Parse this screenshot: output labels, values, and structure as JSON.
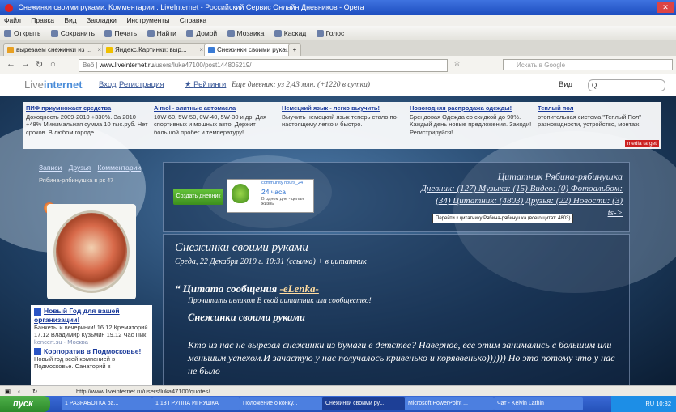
{
  "browser": {
    "title": "Снежинки своими руками. Комментарии : LiveInternet - Российский Сервис Онлайн Дневников - Opera",
    "menu": [
      "Файл",
      "Правка",
      "Вид",
      "Закладки",
      "Инструменты",
      "Справка"
    ],
    "toolbar": [
      "Открыть",
      "Сохранить",
      "Печать",
      "Найти",
      "Домой",
      "Мозаика",
      "Каскад",
      "Голос"
    ],
    "tabs": [
      "вырезаем снежинки из ...",
      "Яндекс.Картинки: выр...",
      "Снежинки своими рука..."
    ],
    "url_prefix": "Веб",
    "url_host": "www.liveinternet.ru",
    "url_path": "/users/luka47100/post144805219/",
    "search_placeholder": "Искать в Google"
  },
  "site": {
    "logo_a": "Live",
    "logo_b": "internet",
    "login": "Вход",
    "register": "Регистрация",
    "ratings": "Рейтинги",
    "stats_text": "Еще дневник: уз 2,43 млн. (+1220 в сутки)",
    "search_label": "Вид",
    "search_placeholder": "Q"
  },
  "ads": [
    {
      "title": "ПИФ приумножает средства",
      "text": "Доходность 2009-2010 +330%. За 2010 +48% Минимальная сумма 10 тыс.руб. Нет сроков. В любом городе"
    },
    {
      "title": "Aimol - элитные автомасла",
      "text": "10W-60, 5W-50, 0W-40, 5W-30 и др. Для спортивных и мощных авто. Держит большой пробег и температуру!"
    },
    {
      "title": "Немецкий язык - легко выучить!",
      "text": "Выучить немецкий язык теперь стало по-настоящему легко и быстро."
    },
    {
      "title": "Новогодняя распродажа одежды!",
      "text": "Брендовая Одежда со скидкой до 90%. Каждый день новые предложения. Заходи! Регистрируйся!"
    },
    {
      "title": "Теплый пол",
      "text": "отопительная система \"Теплый Пол\" разновидности, устройство, монтаж."
    }
  ],
  "media_target": "media target",
  "user_nav": [
    "Записи",
    "Друзья",
    "Комментарии"
  ],
  "greeting": "Рябина-рябинушка в рк 47",
  "sidebar_ads": [
    {
      "title": "Новый Год для вашей организации!",
      "text": "Банкеты и вечеринки! 16.12 Крематорий 17.12 Владимир Кузьмин 19.12 Час Пик",
      "source": "koncert.su · Москва"
    },
    {
      "title": "Корпоратив в Подмосковье!",
      "text": "Новый год всей компанией в Подмосковье. Санаторий в",
      "source": ""
    }
  ],
  "profile": {
    "create_button": "Создать дневник",
    "widget_tag": "community hours_24",
    "widget_hours": "24 часа",
    "widget_sub": "В одном дне - целая жизнь",
    "header": "Цитатник Рябина-рябинушка",
    "line1": "Дневник: (127) Музыка: (15) Видео: (0) Фотоальбом:",
    "line2": "(34) Цитатник: (4803) Друзья: (22) Новости: (3)",
    "next": "ts->",
    "tooltip": "Перейти к цитатнику Рябина-рябинушка (всего цитат: 4803)"
  },
  "post": {
    "title": "Снежинки своими руками",
    "date": "Среда, 22 Декабря 2010 г. 10:31 (ссылка) + в цитатник",
    "quote_prefix": "Цитата сообщения",
    "quote_author": "-eLenka-",
    "quote_link": "Прочитать целиком В свой цитатник или сообщество!",
    "quote_subtitle": "Снежинки своими руками",
    "body": "Кто из нас не вырезал снежинки из бумаги в детстве? Наверное, все этим занимались с большим или меньшим успехом.И зачастую у нас получалось кривенько и коряввенько)))))) Но это потому что у нас не было"
  },
  "status_url": "http://www.liveinternet.ru/users/luka47100/quotes/",
  "taskbar": {
    "start": "пуск",
    "tasks": [
      "1 РАЗРАБОТКА ра...",
      "1 13 ГРУППА ИГРУШКА",
      "Положение о конку...",
      "Снежинки своими ру...",
      "Microsoft PowerPoint ...",
      "Чат - Kelvin Lathin"
    ],
    "tray": "RU 10:32"
  },
  "accent_colors": {
    "link": "#3b5998",
    "create": "#3c8f1d",
    "taskbar": "#2451b8"
  }
}
